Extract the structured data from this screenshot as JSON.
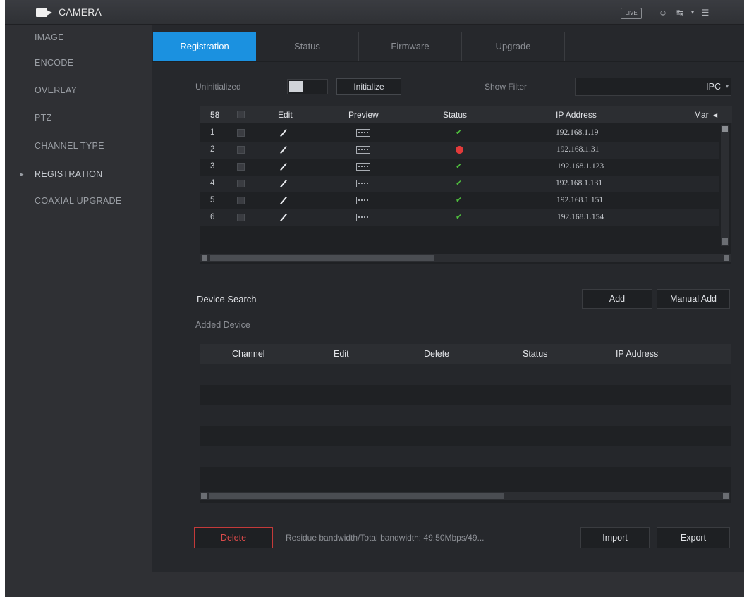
{
  "app": {
    "title": "CAMERA",
    "live_label": "LIVE"
  },
  "topbar_icons": [
    "user-icon",
    "logout-icon",
    "menu-icon"
  ],
  "sidebar": {
    "items": [
      {
        "label": "IMAGE",
        "active": false
      },
      {
        "label": "ENCODE",
        "active": false
      },
      {
        "label": "OVERLAY",
        "active": false
      },
      {
        "label": "PTZ",
        "active": false
      },
      {
        "label": "CHANNEL TYPE",
        "active": false
      },
      {
        "label": "REGISTRATION",
        "active": true
      },
      {
        "label": "COAXIAL UPGRADE",
        "active": false
      }
    ]
  },
  "tabs": [
    {
      "label": "Registration",
      "active": true
    },
    {
      "label": "Status",
      "active": false
    },
    {
      "label": "Firmware",
      "active": false
    },
    {
      "label": "Upgrade",
      "active": false
    }
  ],
  "init_row": {
    "uninitialized_label": "Uninitialized",
    "initialize_label": "Initialize",
    "show_filter_label": "Show Filter",
    "filter_value": "IPC"
  },
  "device_table": {
    "columns": [
      "58",
      "Edit",
      "Preview",
      "Status",
      "IP Address",
      "Mar"
    ],
    "rows": [
      {
        "num": "1",
        "status": "ok",
        "ip": "192.168.1.19"
      },
      {
        "num": "2",
        "status": "error",
        "ip": "192.168.1.31"
      },
      {
        "num": "3",
        "status": "ok",
        "ip": "192.168.1.123"
      },
      {
        "num": "4",
        "status": "ok",
        "ip": "192.168.1.131"
      },
      {
        "num": "5",
        "status": "ok",
        "ip": "192.168.1.151"
      },
      {
        "num": "6",
        "status": "ok",
        "ip": "192.168.1.154"
      }
    ]
  },
  "search": {
    "device_search_label": "Device Search",
    "add_label": "Add",
    "manual_add_label": "Manual Add",
    "added_device_label": "Added Device"
  },
  "added_table": {
    "columns": [
      "Channel",
      "Edit",
      "Delete",
      "Status",
      "IP Address"
    ],
    "rows": []
  },
  "bottom": {
    "delete_label": "Delete",
    "bandwidth_text": "Residue bandwidth/Total bandwidth: 49.50Mbps/49...",
    "import_label": "Import",
    "export_label": "Export"
  },
  "colors": {
    "accent": "#1b91e0",
    "ok": "#4fbf3d",
    "error": "#e23a3a",
    "delete": "#d94a4a"
  }
}
